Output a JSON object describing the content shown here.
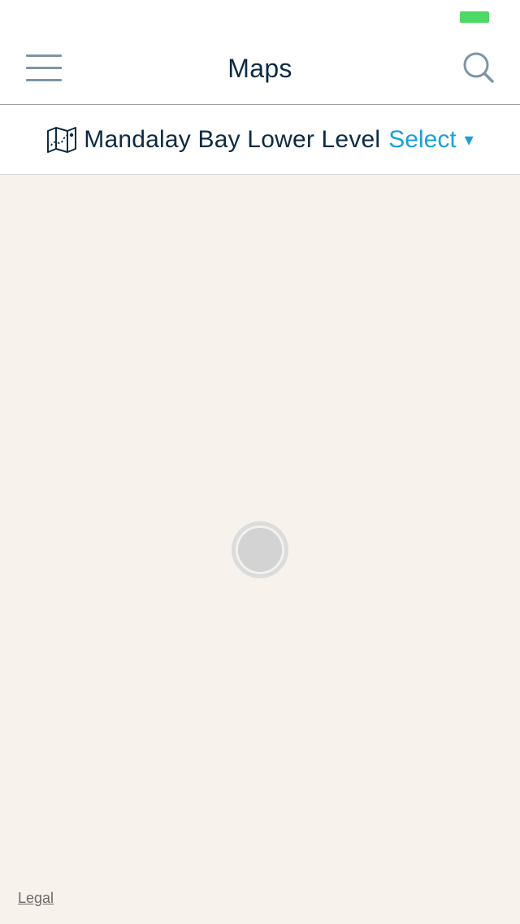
{
  "status_bar": {
    "battery_color": "#4cd964"
  },
  "header": {
    "title": "Maps",
    "menu_icon": "hamburger-menu-icon",
    "search_icon": "search-icon",
    "title_color": "#0d2a43",
    "icon_color": "#7d95a6"
  },
  "location": {
    "icon": "map-icon",
    "name": "Mandalay Bay Lower Level",
    "select_label": "Select",
    "caret": "▾",
    "name_color": "#0d2a43",
    "select_color": "#1ba0d7"
  },
  "map": {
    "background": "#f7f3ec",
    "legal_label": "Legal",
    "legal_color": "#6f6a62"
  }
}
